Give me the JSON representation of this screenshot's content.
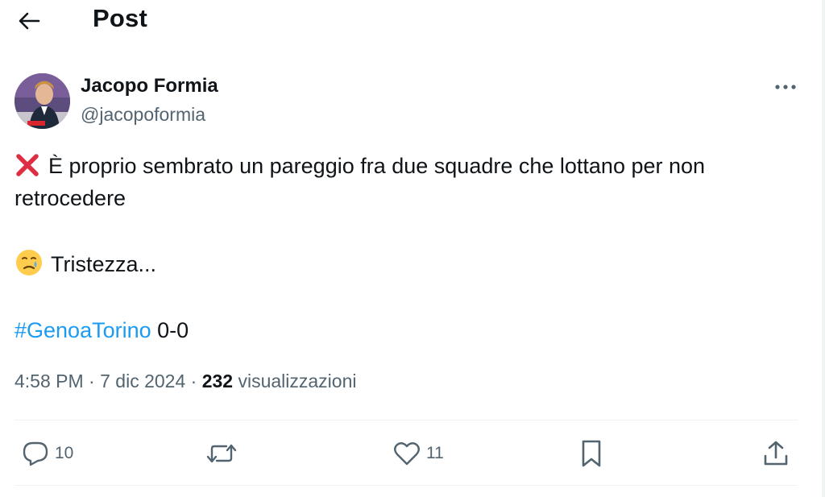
{
  "header": {
    "title": "Post"
  },
  "author": {
    "name": "Jacopo Formia",
    "handle": "@jacopoformia"
  },
  "tweet": {
    "line1": "È proprio sembrato un pareggio fra due squadre che lottano per non",
    "line2": "retrocedere",
    "line3": "Tristezza...",
    "hashtag": "#GenoaTorino",
    "score": " 0-0"
  },
  "meta": {
    "time": "4:58 PM",
    "date": "7 dic 2024",
    "separator": " · ",
    "views_count": "232",
    "views_label": " visualizzazioni"
  },
  "actions": {
    "replies": "10",
    "likes": "11"
  },
  "colors": {
    "accent": "#1d9bf0",
    "secondary_text": "#536471",
    "divider": "#eff3f4"
  }
}
